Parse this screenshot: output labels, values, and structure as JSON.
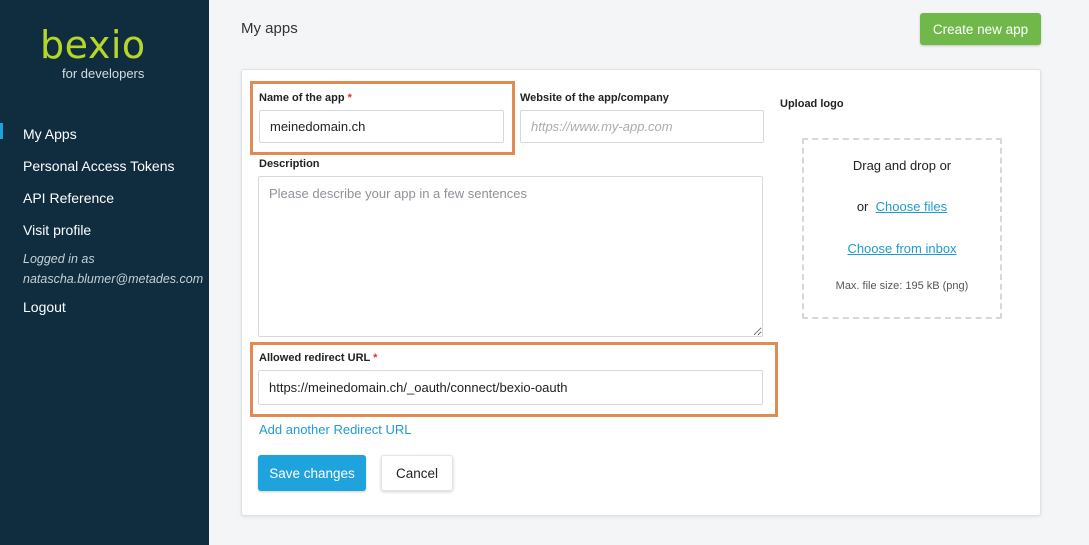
{
  "sidebar": {
    "logo": {
      "main": "bexio",
      "sub": "for developers"
    },
    "items": [
      {
        "label": "My Apps",
        "active": true
      },
      {
        "label": "Personal Access Tokens"
      },
      {
        "label": "API Reference"
      },
      {
        "label": "Visit profile"
      }
    ],
    "logged_in_label": "Logged in as",
    "logged_in_user": "natascha.blumer@metades.com",
    "logout_label": "Logout"
  },
  "header": {
    "title": "My apps",
    "create_button": "Create new app"
  },
  "form": {
    "name": {
      "label": "Name of the app",
      "required_mark": "*",
      "value": "meinedomain.ch"
    },
    "website": {
      "label": "Website of the app/company",
      "placeholder": "https://www.my-app.com",
      "value": ""
    },
    "description": {
      "label": "Description",
      "placeholder": "Please describe your app in a few sentences",
      "value": ""
    },
    "redirect": {
      "label": "Allowed redirect URL",
      "required_mark": "*",
      "value": "https://meinedomain.ch/_oauth/connect/bexio-oauth"
    },
    "add_redirect_link": "Add another Redirect URL",
    "upload": {
      "label": "Upload logo",
      "drag_text": "Drag and drop  or",
      "or_text": "or",
      "choose_files": "Choose files",
      "choose_inbox": "Choose from inbox",
      "max_size": "Max. file size: 195 kB (png)"
    },
    "save_button": "Save changes",
    "cancel_button": "Cancel"
  },
  "colors": {
    "sidebar_bg": "#0f2d3e",
    "logo": "#b6d62a",
    "create_button": "#71b84b",
    "save_button": "#1ea3dc",
    "link": "#1e9ccf",
    "highlight": "#e08b4f"
  }
}
